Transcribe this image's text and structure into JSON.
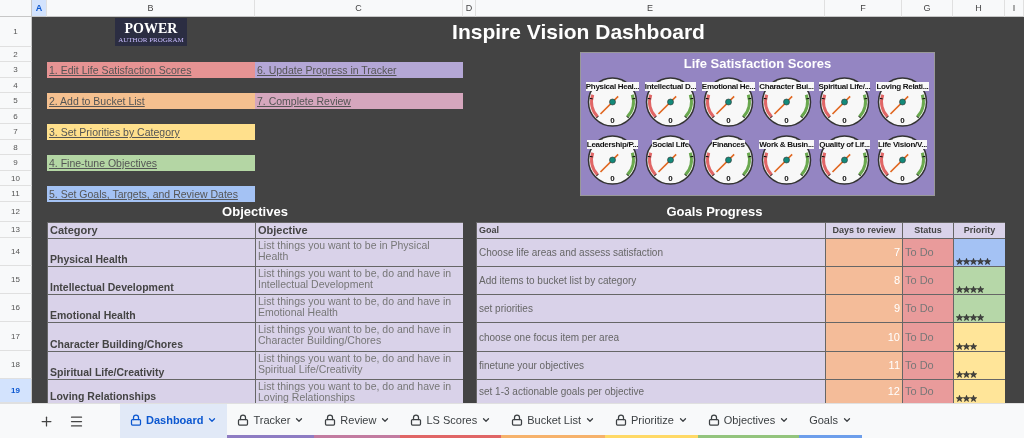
{
  "column_headers": [
    {
      "label": "A",
      "selected": true
    },
    {
      "label": "B",
      "selected": false
    },
    {
      "label": "C",
      "selected": false
    },
    {
      "label": "D",
      "selected": false
    },
    {
      "label": "E",
      "selected": false
    },
    {
      "label": "F",
      "selected": false
    },
    {
      "label": "G",
      "selected": false
    },
    {
      "label": "H",
      "selected": false
    },
    {
      "label": "I",
      "selected": false
    }
  ],
  "row_headers": [
    {
      "label": "1",
      "selected": false
    },
    {
      "label": "2",
      "selected": false
    },
    {
      "label": "3",
      "selected": false
    },
    {
      "label": "4",
      "selected": false
    },
    {
      "label": "5",
      "selected": false
    },
    {
      "label": "6",
      "selected": false
    },
    {
      "label": "7",
      "selected": false
    },
    {
      "label": "8",
      "selected": false
    },
    {
      "label": "9",
      "selected": false
    },
    {
      "label": "10",
      "selected": false
    },
    {
      "label": "11",
      "selected": false
    },
    {
      "label": "12",
      "selected": false
    },
    {
      "label": "13",
      "selected": false
    },
    {
      "label": "14",
      "selected": false
    },
    {
      "label": "15",
      "selected": false
    },
    {
      "label": "16",
      "selected": false
    },
    {
      "label": "17",
      "selected": false
    },
    {
      "label": "18",
      "selected": false
    },
    {
      "label": "19",
      "selected": true
    }
  ],
  "logo": {
    "title": "POWER",
    "subtitle": "AUTHOR PROGRAM"
  },
  "title": "Inspire Vision Dashboard",
  "links": [
    {
      "label": "1. Edit Life Satisfaction Scores",
      "color": "#e69393"
    },
    {
      "label": "2. Add to Bucket List",
      "color": "#f5c08f"
    },
    {
      "label": "3. Set Priorities by Category",
      "color": "#ffe08c"
    },
    {
      "label": "4. Fine-tune Objectives",
      "color": "#b4d6a4"
    },
    {
      "label": "5. Set Goals, Targets, and Review Dates",
      "color": "#a4c2f4"
    },
    {
      "label": "6. Update Progress in Tracker",
      "color": "#b4a7d6"
    },
    {
      "label": "7. Complete Review",
      "color": "#d5a6bd"
    }
  ],
  "gauge_panel": {
    "title": "Life Satisfaction Scores",
    "gauges": [
      {
        "label": "Physical Heal...",
        "reading": "0"
      },
      {
        "label": "Intellectual D...",
        "reading": "0"
      },
      {
        "label": "Emotional He...",
        "reading": "0"
      },
      {
        "label": "Character Bui...",
        "reading": "0"
      },
      {
        "label": "Spiritual Life/...",
        "reading": "0"
      },
      {
        "label": "Loving Relati...",
        "reading": "0"
      },
      {
        "label": "Leadership/P...",
        "reading": "0"
      },
      {
        "label": "Social Life",
        "reading": "0"
      },
      {
        "label": "Finances",
        "reading": "0"
      },
      {
        "label": "Work & Busin...",
        "reading": "0"
      },
      {
        "label": "Quality of Lif...",
        "reading": "0"
      },
      {
        "label": "Life Vision/V...",
        "reading": "0"
      }
    ]
  },
  "objectives": {
    "title": "Objectives",
    "columns": [
      "Category",
      "Objective"
    ],
    "rows": [
      {
        "category": "Physical Health",
        "objective": "List things you want to be in Physical Health"
      },
      {
        "category": "Intellectual Development",
        "objective": "List things you want to be, do and have in Intellectual Development"
      },
      {
        "category": "Emotional Health",
        "objective": "List things you want to be, do and have in Emotional Health"
      },
      {
        "category": "Character Building/Chores",
        "objective": "List things you want to be, do and have in Character Building/Chores"
      },
      {
        "category": "Spiritual Life/Creativity",
        "objective": "List things you want to be, do and have in Spiritual Life/Creativity"
      },
      {
        "category": "Loving Relationships",
        "objective": "List things you want to be, do and have in Loving Relationships"
      }
    ]
  },
  "goals": {
    "title": "Goals Progress",
    "columns": [
      "Goal",
      "Days to review",
      "Status",
      "Priority"
    ],
    "rows": [
      {
        "goal": "Choose life areas and assess satisfaction",
        "days": "7",
        "status": "To Do",
        "stars": 5,
        "color": "#a4c2f4"
      },
      {
        "goal": "Add items to bucket list by category",
        "days": "8",
        "status": "To Do",
        "stars": 4,
        "color": "#b6d7a8"
      },
      {
        "goal": "set priorities",
        "days": "9",
        "status": "To Do",
        "stars": 4,
        "color": "#b6d7a8"
      },
      {
        "goal": "choose one focus item per area",
        "days": "10",
        "status": "To Do",
        "stars": 3,
        "color": "#ffe599"
      },
      {
        "goal": "finetune your objectives",
        "days": "11",
        "status": "To Do",
        "stars": 3,
        "color": "#ffe599"
      },
      {
        "goal": "set 1-3 actionable goals per objective",
        "days": "12",
        "status": "To Do",
        "stars": 3,
        "color": "#ffe599"
      }
    ]
  },
  "sheet_tabs": [
    {
      "label": "Dashboard",
      "selected": true,
      "locked": true,
      "color": "#e1e9f7"
    },
    {
      "label": "Tracker",
      "selected": false,
      "locked": true,
      "color": "#8e7cc3"
    },
    {
      "label": "Review",
      "selected": false,
      "locked": true,
      "color": "#c27ba0"
    },
    {
      "label": "LS Scores",
      "selected": false,
      "locked": true,
      "color": "#e06666"
    },
    {
      "label": "Bucket List",
      "selected": false,
      "locked": true,
      "color": "#f6b26b"
    },
    {
      "label": "Prioritize",
      "selected": false,
      "locked": true,
      "color": "#ffd966"
    },
    {
      "label": "Objectives",
      "selected": false,
      "locked": true,
      "color": "#93c47d"
    },
    {
      "label": "Goals",
      "selected": false,
      "locked": false,
      "color": "#6d9eeb"
    }
  ]
}
